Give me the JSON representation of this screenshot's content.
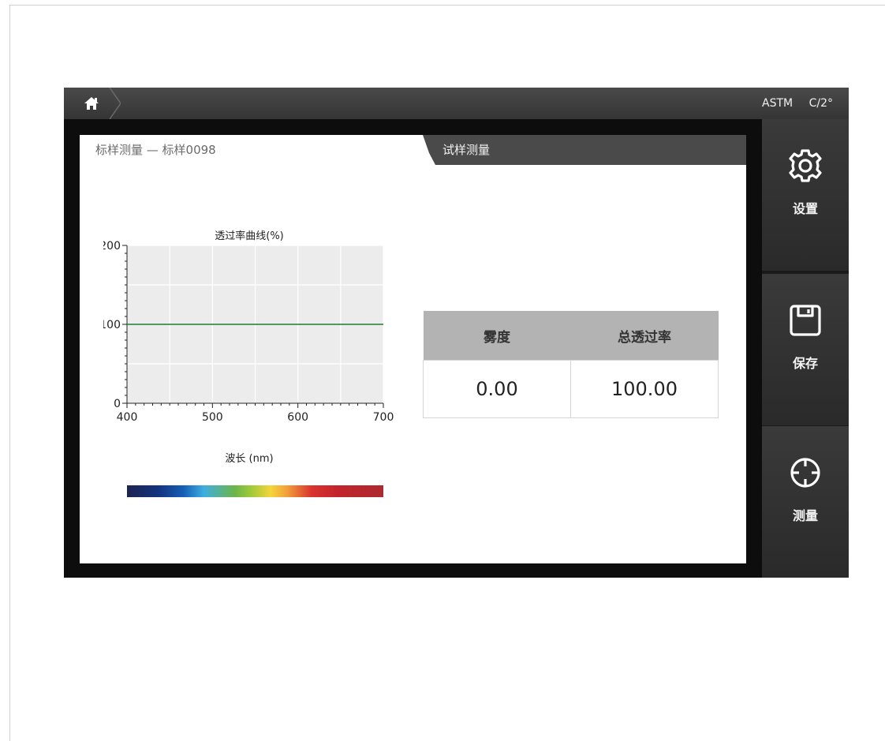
{
  "topbar": {
    "standard": "ASTM",
    "illuminant_observer": "C/2°"
  },
  "tabs": {
    "active_label": "标样测量 — 标样0098",
    "inactive_label": "试样测量"
  },
  "chart_data": {
    "type": "line",
    "title": "透过率曲线(%)",
    "xlabel": "波长 (nm)",
    "ylabel": "",
    "xlim": [
      400,
      700
    ],
    "ylim": [
      0,
      200
    ],
    "xticks": [
      "400",
      "500",
      "600",
      "700"
    ],
    "yticks": [
      "0",
      "100",
      "200"
    ],
    "x": [
      400,
      700
    ],
    "series": [
      {
        "values": [
          100,
          100
        ],
        "color": "#1f7a2e"
      }
    ],
    "grid": true,
    "background": "#ececec"
  },
  "results": {
    "haze_label": "雾度",
    "transmittance_label": "总透过率",
    "haze_value": "0.00",
    "transmittance_value": "100.00"
  },
  "side_menu": {
    "settings_label": "设置",
    "save_label": "保存",
    "measure_label": "测量",
    "icons": [
      "gear-icon",
      "floppy-disk-icon",
      "crosshair-icon"
    ]
  },
  "colors": {
    "topbar": "#3f3f3f",
    "device_frame": "#0d0d0d",
    "table_header": "#b3b3b3",
    "curve": "#1f7a2e"
  }
}
